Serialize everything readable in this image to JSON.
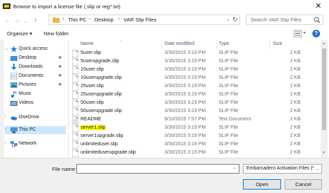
{
  "window": {
    "title": "Browse to import a license file (.slip or reg*.txt)",
    "close_glyph": "✕"
  },
  "address": {
    "crumbs": [
      "This PC",
      "Desktop",
      "VAR Slip Files"
    ],
    "separator": "›",
    "search_placeholder": "Search VAR Slip Files"
  },
  "toolbar": {
    "organize_label": "Organize ▾",
    "new_folder_label": "New folder",
    "help_glyph": "?"
  },
  "sidebar": {
    "items": [
      {
        "label": "Quick access",
        "icon": "star-icon",
        "pinned": false
      },
      {
        "label": "Desktop",
        "icon": "desktop-folder-icon",
        "pinned": true
      },
      {
        "label": "Downloads",
        "icon": "downloads-icon",
        "pinned": true
      },
      {
        "label": "Documents",
        "icon": "documents-icon",
        "pinned": true
      },
      {
        "label": "Pictures",
        "icon": "pictures-icon",
        "pinned": true
      },
      {
        "label": "Music",
        "icon": "music-icon",
        "pinned": false
      },
      {
        "label": "Videos",
        "icon": "videos-icon",
        "pinned": false
      },
      {
        "label": "OneDrive",
        "icon": "onedrive-icon",
        "pinned": false
      },
      {
        "label": "This PC",
        "icon": "computer-icon",
        "pinned": false,
        "selected": true
      },
      {
        "label": "Network",
        "icon": "network-icon",
        "pinned": false
      }
    ]
  },
  "columns": {
    "name": "Name",
    "date": "Date modified",
    "type": "Type",
    "size": "Size"
  },
  "files": [
    {
      "name": "5user.slip",
      "date": "3/30/2015 3:19 PM",
      "type": "SLIP File",
      "size": "2 KB"
    },
    {
      "name": "5userupgrade.slip",
      "date": "3/30/2015 3:19 PM",
      "type": "SLIP File",
      "size": "2 KB"
    },
    {
      "name": "10user.slip",
      "date": "3/30/2015 3:19 PM",
      "type": "SLIP File",
      "size": "2 KB"
    },
    {
      "name": "10userupgrade.slip",
      "date": "3/30/2015 3:19 PM",
      "type": "SLIP File",
      "size": "2 KB"
    },
    {
      "name": "25user.slip",
      "date": "3/30/2015 3:19 PM",
      "type": "SLIP File",
      "size": "2 KB"
    },
    {
      "name": "25userupgrade.slip",
      "date": "3/30/2015 3:19 PM",
      "type": "SLIP File",
      "size": "2 KB"
    },
    {
      "name": "50user.slip",
      "date": "3/30/2015 3:19 PM",
      "type": "SLIP File",
      "size": "2 KB"
    },
    {
      "name": "50userupgrade.slip",
      "date": "3/30/2015 3:19 PM",
      "type": "SLIP File",
      "size": "2 KB"
    },
    {
      "name": "README",
      "date": "8/10/2015 7:57 PM",
      "type": "Text Document",
      "size": "2 KB"
    },
    {
      "name": "server1.slip",
      "date": "3/30/2015 3:19 PM",
      "type": "SLIP File",
      "size": "2 KB",
      "highlight": true
    },
    {
      "name": "server1upgrade.slip",
      "date": "3/30/2015 3:19 PM",
      "type": "SLIP File",
      "size": "2 KB"
    },
    {
      "name": "unlimiteduser.slip",
      "date": "3/30/2015 3:19 PM",
      "type": "SLIP File",
      "size": "2 KB"
    },
    {
      "name": "unlimiteduserupgrade.slip",
      "date": "3/30/2015 3:19 PM",
      "type": "SLIP File",
      "size": "2 KB"
    }
  ],
  "footer": {
    "file_name_label": "File name:",
    "file_name_value": "",
    "filter_value": "Embarcadero Activation Files (*",
    "open_label": "Open",
    "cancel_label": "Cancel"
  },
  "colors": {
    "highlight": "#ffff00",
    "selected_nav": "#cce8ff",
    "accent": "#0078d7"
  }
}
